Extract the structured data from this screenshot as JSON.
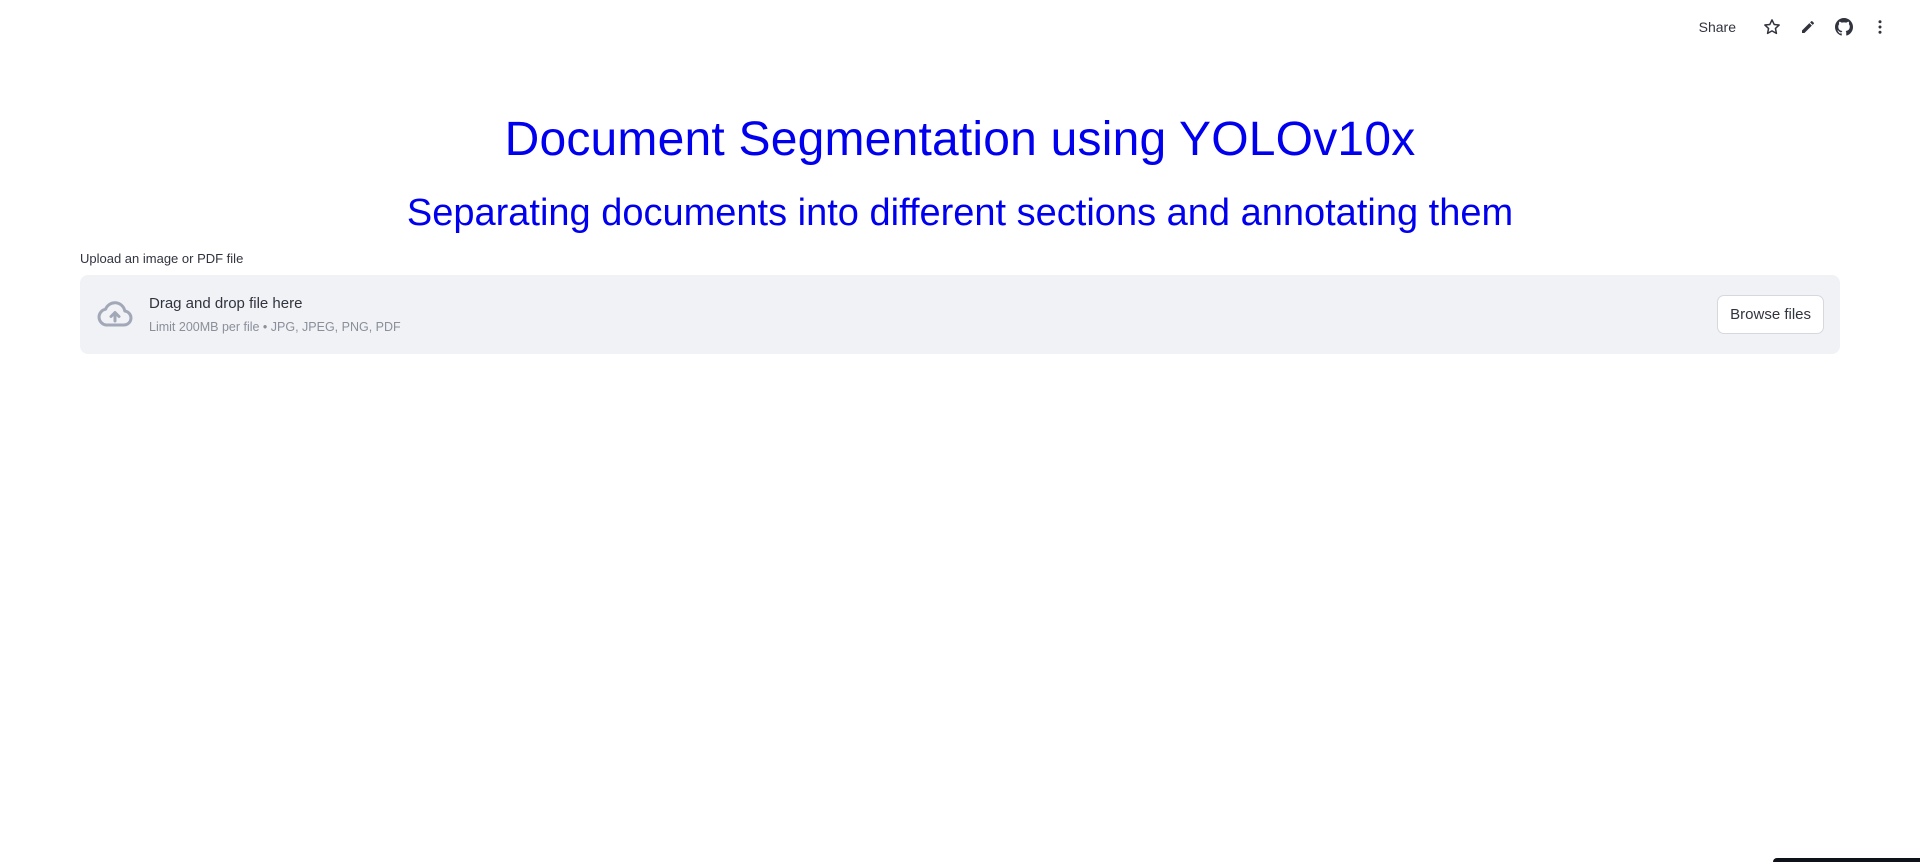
{
  "toolbar": {
    "share_label": "Share",
    "icons": [
      "star-icon",
      "pencil-icon",
      "github-icon",
      "more-vertical-icon"
    ]
  },
  "main": {
    "title": "Document Segmentation using YOLOv10x",
    "subtitle": "Separating documents into different sections and annotating them",
    "title_color": "#0000EE"
  },
  "uploader": {
    "label": "Upload an image or PDF file",
    "drop_text": "Drag and drop file here",
    "limit_text": "Limit 200MB per file • JPG, JPEG, PNG, PDF",
    "browse_label": "Browse files",
    "icon": "cloud-upload-icon"
  }
}
